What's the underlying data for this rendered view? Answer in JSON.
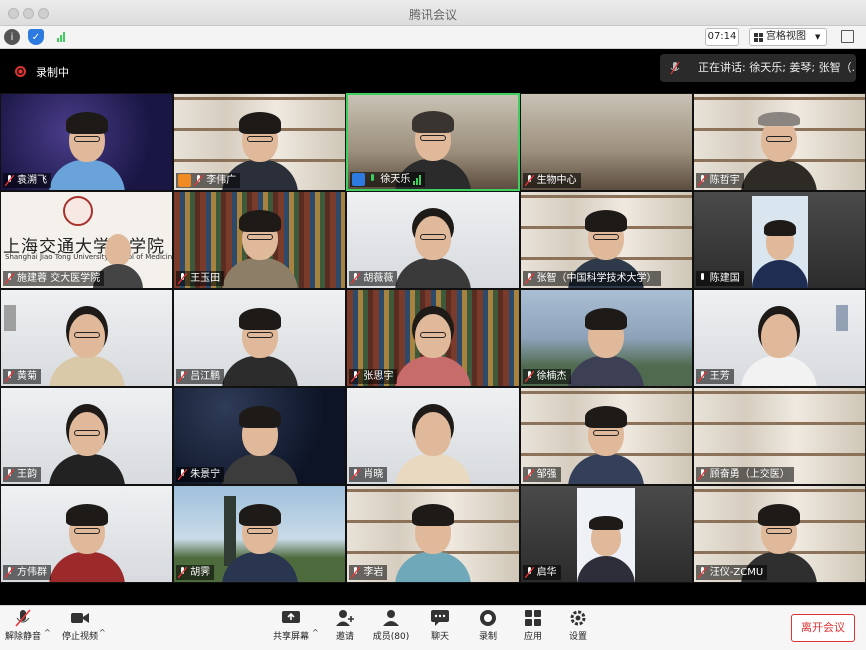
{
  "window": {
    "title": "腾讯会议"
  },
  "top_toolbar": {
    "timer": "07:14",
    "view_label": "宫格视图"
  },
  "recording": {
    "label": "录制中"
  },
  "speaking": {
    "text": "正在讲话: 徐天乐; 姜琴; 张智（..."
  },
  "participants": [
    {
      "name": "袁溯飞"
    },
    {
      "name": "李伟广"
    },
    {
      "name": "徐天乐"
    },
    {
      "name": "生物中心"
    },
    {
      "name": "陈哲宇"
    },
    {
      "name": "施建蓉 交大医学院",
      "sjtu_text": "上海交通大学医学院",
      "sjtu_en": "Shanghai Jiao Tong University School of Medicine"
    },
    {
      "name": "王玉田"
    },
    {
      "name": "胡薇薇"
    },
    {
      "name": "张智（中国科学技术大学）"
    },
    {
      "name": "陈建国"
    },
    {
      "name": "黄菊"
    },
    {
      "name": "吕江鹏"
    },
    {
      "name": "张思宇"
    },
    {
      "name": "徐楠杰"
    },
    {
      "name": "王芳"
    },
    {
      "name": "王韵"
    },
    {
      "name": "朱景宁"
    },
    {
      "name": "肖晓"
    },
    {
      "name": "邹强"
    },
    {
      "name": "顾奋勇（上交医）"
    },
    {
      "name": "方伟群"
    },
    {
      "name": "胡霁"
    },
    {
      "name": "李岩"
    },
    {
      "name": "启华"
    },
    {
      "name": "汪仪-ZCMU"
    }
  ],
  "bottom_toolbar": {
    "unmute": "解除静音",
    "stop_video": "停止视频",
    "share": "共享屏幕",
    "invite": "邀请",
    "members": "成员(80)",
    "chat": "聊天",
    "record": "录制",
    "apps": "应用",
    "settings": "设置",
    "leave": "离开会议"
  },
  "colors": {
    "active_speaker": "#3ecf5e",
    "record_red": "#dd3333",
    "host_badge": "#f08a24",
    "leave_red": "#dd3333"
  }
}
